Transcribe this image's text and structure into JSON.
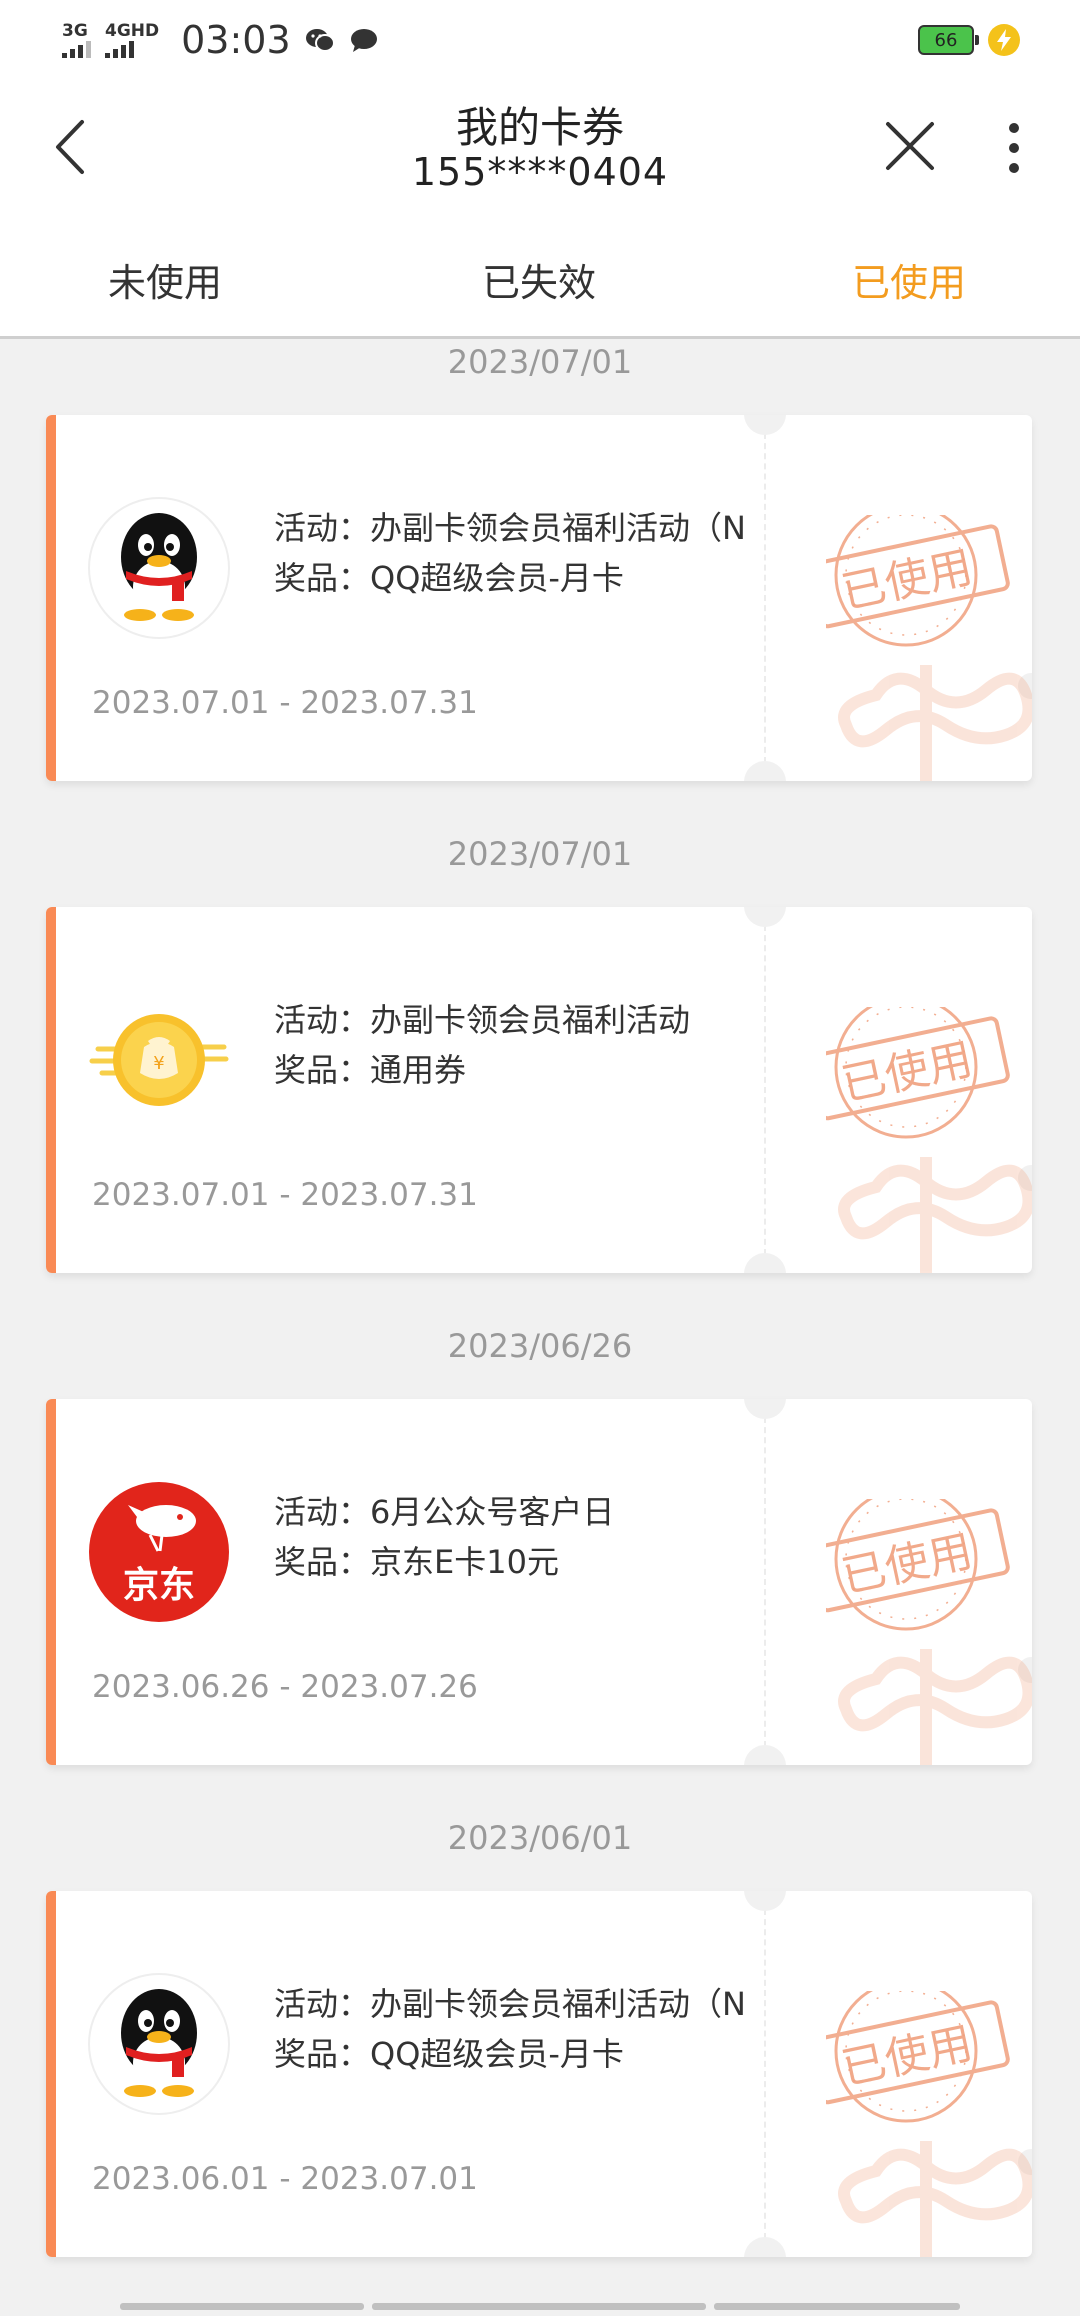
{
  "status_bar": {
    "signal1_label": "3G",
    "signal2_label": "4GHD",
    "time": "03:03",
    "battery": "66"
  },
  "header": {
    "title": "我的卡券",
    "subtitle": "155****0404"
  },
  "tabs": [
    {
      "label": "未使用",
      "active": false
    },
    {
      "label": "已失效",
      "active": false
    },
    {
      "label": "已使用",
      "active": true
    }
  ],
  "coupons": [
    {
      "date": "2023/07/01",
      "activity": "活动：办副卡领会员福利活动（N",
      "prize": "奖品：QQ超级会员-月卡",
      "range": "2023.07.01 - 2023.07.31",
      "logo": "qq-penguin-icon",
      "stamp": "已使用"
    },
    {
      "date": "2023/07/01",
      "activity": "活动：办副卡领会员福利活动",
      "prize": "奖品：通用券",
      "range": "2023.07.01 - 2023.07.31",
      "logo": "money-bag-coin-icon",
      "stamp": "已使用"
    },
    {
      "date": "2023/06/26",
      "activity": "活动：6月公众号客户日",
      "prize": "奖品：京东E卡10元",
      "range": "2023.06.26 - 2023.07.26",
      "logo": "jd-logo-icon",
      "logo_text": "京东",
      "stamp": "已使用"
    },
    {
      "date": "2023/06/01",
      "activity": "活动：办副卡领会员福利活动（N",
      "prize": "奖品：QQ超级会员-月卡",
      "range": "2023.06.01 - 2023.07.01",
      "logo": "qq-penguin-icon",
      "stamp": "已使用"
    }
  ],
  "colors": {
    "accent": "#f39c1f",
    "card_edge": "#f98a55",
    "stamp": "#f0a07e",
    "jd_red": "#e1251b"
  }
}
